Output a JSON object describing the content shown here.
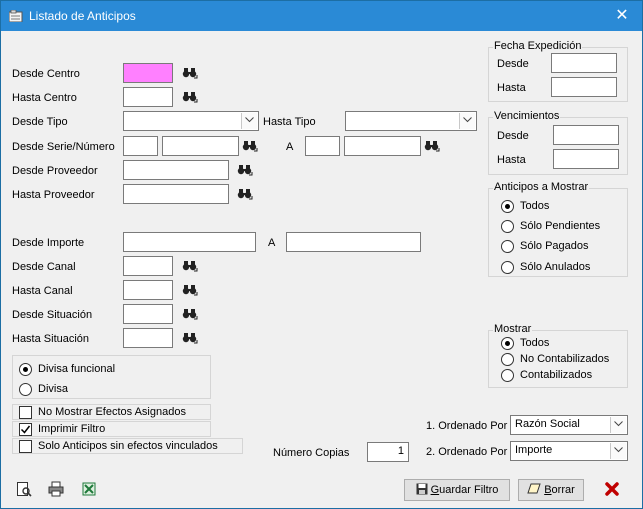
{
  "window": {
    "title": "Listado de Anticipos"
  },
  "fields": {
    "desde_centro": "Desde Centro",
    "hasta_centro": "Hasta Centro",
    "desde_tipo": "Desde Tipo",
    "hasta_tipo": "Hasta Tipo",
    "desde_serie": "Desde Serie/Número",
    "serie_a": "A",
    "desde_proveedor": "Desde Proveedor",
    "hasta_proveedor": "Hasta Proveedor",
    "desde_importe": "Desde Importe",
    "importe_a": "A",
    "desde_canal": "Desde Canal",
    "hasta_canal": "Hasta Canal",
    "desde_situacion": "Desde Situación",
    "hasta_situacion": "Hasta Situación"
  },
  "divisa": {
    "options": [
      "Divisa funcional",
      "Divisa"
    ],
    "selected": 0
  },
  "checkboxes": [
    {
      "label": "No Mostrar Efectos Asignados",
      "checked": false
    },
    {
      "label": "Imprimir Filtro",
      "checked": true
    },
    {
      "label": "Solo Anticipos sin efectos vinculados",
      "checked": false
    }
  ],
  "fecha_expedicion": {
    "title": "Fecha Expedición",
    "desde": "Desde",
    "hasta": "Hasta"
  },
  "vencimientos": {
    "title": "Vencimientos",
    "desde": "Desde",
    "hasta": "Hasta"
  },
  "anticipos_mostrar": {
    "title": "Anticipos a Mostrar",
    "options": [
      "Todos",
      "Sólo Pendientes",
      "Sólo Pagados",
      "Sólo Anulados"
    ],
    "selected": 0
  },
  "mostrar": {
    "title": "Mostrar",
    "options": [
      "Todos",
      "No Contabilizados",
      "Contabilizados"
    ],
    "selected": 0
  },
  "ordenado1": {
    "label": "1. Ordenado Por",
    "value": "Razón Social"
  },
  "ordenado2": {
    "label": "2. Ordenado Por",
    "value": "Importe"
  },
  "copias": {
    "label": "Número Copias",
    "value": "1"
  },
  "buttons": {
    "guardar_u": "G",
    "guardar_rest": "uardar Filtro",
    "borrar_u": "B",
    "borrar_rest": "orrar"
  },
  "colors": {
    "titlebar": "#2a8ad6",
    "focused_input": "#ff80ff",
    "close_red": "#c00000"
  },
  "icons": [
    "binoculars-icon",
    "print-preview-icon",
    "printer-icon",
    "excel-export-icon",
    "floppy-disk-icon",
    "eraser-icon",
    "red-x-icon"
  ]
}
